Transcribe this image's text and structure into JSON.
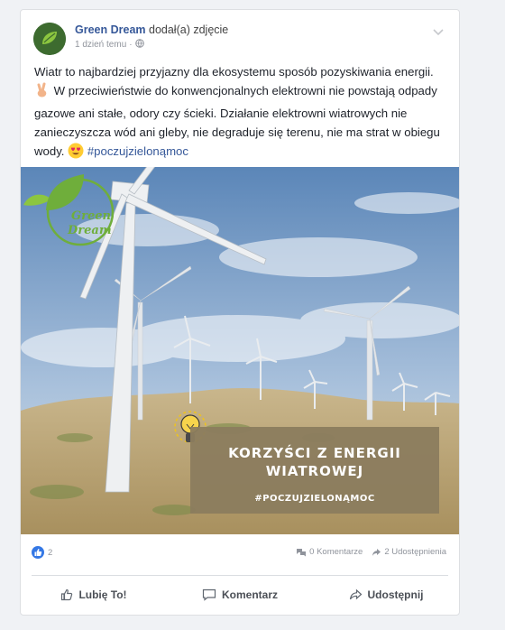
{
  "post": {
    "author": "Green Dream",
    "action": "dodał(a) zdjęcie",
    "time": "1 dzień temu",
    "sep": "·",
    "text_line1": "Wiatr to najbardziej przyjazny dla ekosystemu sposób pozyskiwania energii.",
    "text_line2": " W przeciwieństwie do konwencjonalnych elektrowni nie powstają odpady gazowe ani stałe, odory czy ścieki. Działanie elektrowni wiatrowych nie zanieczyszcza wód ani gleby, nie degraduje się terenu, nie ma strat w obiegu wody.",
    "hashtag": "#poczujzielonąmoc"
  },
  "image": {
    "logo_line1": "Green",
    "logo_line2": "Dream",
    "banner_title_1": "KORZYŚCI Z ENERGII",
    "banner_title_2": "WIATROWEJ",
    "banner_tag": "#POCZUJZIELONĄMOC"
  },
  "stats": {
    "likes": "2",
    "comments": "0 Komentarze",
    "shares": "2 Udostępnienia"
  },
  "actions": {
    "like": "Lubię To!",
    "comment": "Komentarz",
    "share": "Udostępnij"
  },
  "colors": {
    "link": "#365899",
    "like_blue": "#3578e5",
    "banner": "#8b7c5e"
  },
  "icons": [
    "chevron-down-icon",
    "globe-icon",
    "victory-hand-emoji",
    "heart-eyes-emoji",
    "lightbulb-icon",
    "like-icon",
    "comment-icon",
    "share-icon"
  ]
}
